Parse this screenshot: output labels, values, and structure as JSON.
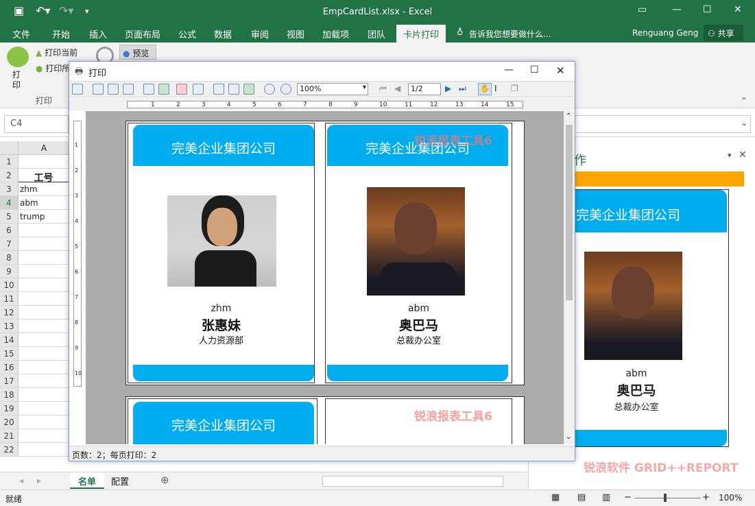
{
  "title_bar": {
    "title": "EmpCardList.xlsx - Excel"
  },
  "ribbon_tabs": [
    "文件",
    "开始",
    "插入",
    "页面布局",
    "公式",
    "数据",
    "审阅",
    "视图",
    "加载项",
    "团队",
    "卡片打印"
  ],
  "tell_me": "告诉我您想要做什么...",
  "user_name": "Renguang Geng",
  "share_label": "共享",
  "ribbon": {
    "print_big_label": "打印",
    "print_current": "打印当前",
    "print_all": "打印所",
    "preview": "预览",
    "group_label": "打印"
  },
  "name_box": "C4",
  "column_header": "A",
  "sheet_rows": [
    {
      "row": "1",
      "value": ""
    },
    {
      "row": "2",
      "value": "工号"
    },
    {
      "row": "3",
      "value": "zhm"
    },
    {
      "row": "4",
      "value": "abm"
    },
    {
      "row": "5",
      "value": "trump"
    },
    {
      "row": "6",
      "value": ""
    },
    {
      "row": "7",
      "value": ""
    },
    {
      "row": "8",
      "value": ""
    },
    {
      "row": "9",
      "value": ""
    },
    {
      "row": "10",
      "value": ""
    },
    {
      "row": "11",
      "value": ""
    },
    {
      "row": "12",
      "value": ""
    },
    {
      "row": "13",
      "value": ""
    },
    {
      "row": "14",
      "value": ""
    },
    {
      "row": "15",
      "value": ""
    },
    {
      "row": "16",
      "value": ""
    },
    {
      "row": "17",
      "value": ""
    },
    {
      "row": "18",
      "value": ""
    },
    {
      "row": "19",
      "value": ""
    },
    {
      "row": "20",
      "value": ""
    },
    {
      "row": "21",
      "value": ""
    },
    {
      "row": "22",
      "value": ""
    }
  ],
  "sheet_tabs": [
    "名单",
    "配置"
  ],
  "status": {
    "ready": "就绪",
    "zoom": "100%"
  },
  "dialog": {
    "title": "打印",
    "zoom": "100%",
    "page": "1/2",
    "status": "页数：2；每页打印：2",
    "ruler_numbers": [
      "1",
      "2",
      "3",
      "4",
      "5",
      "6",
      "7",
      "8",
      "9",
      "10",
      "11",
      "12",
      "13",
      "14",
      "15"
    ],
    "vruler_numbers": [
      "1",
      "2",
      "3",
      "4",
      "5",
      "6",
      "7",
      "8",
      "9",
      "10"
    ]
  },
  "cards": [
    {
      "company": "完美企业集团公司",
      "id": "zhm",
      "name": "张惠妹",
      "dept": "人力资源部"
    },
    {
      "company": "完美企业集团公司",
      "id": "abm",
      "name": "奥巴马",
      "dept": "总裁办公室"
    },
    {
      "company": "完美企业集团公司"
    }
  ],
  "side_panel": {
    "title": "作",
    "card": {
      "company": "完美企业集团公司",
      "id": "abm",
      "name": "奥巴马",
      "dept": "总裁办公室"
    }
  },
  "watermark": "锐浪报表工具6",
  "watermark2": "锐浪软件 GRID++REPORT",
  "colors": {
    "excel_green": "#217346",
    "card_blue": "#00adef",
    "panel_orange": "#ffa500"
  }
}
